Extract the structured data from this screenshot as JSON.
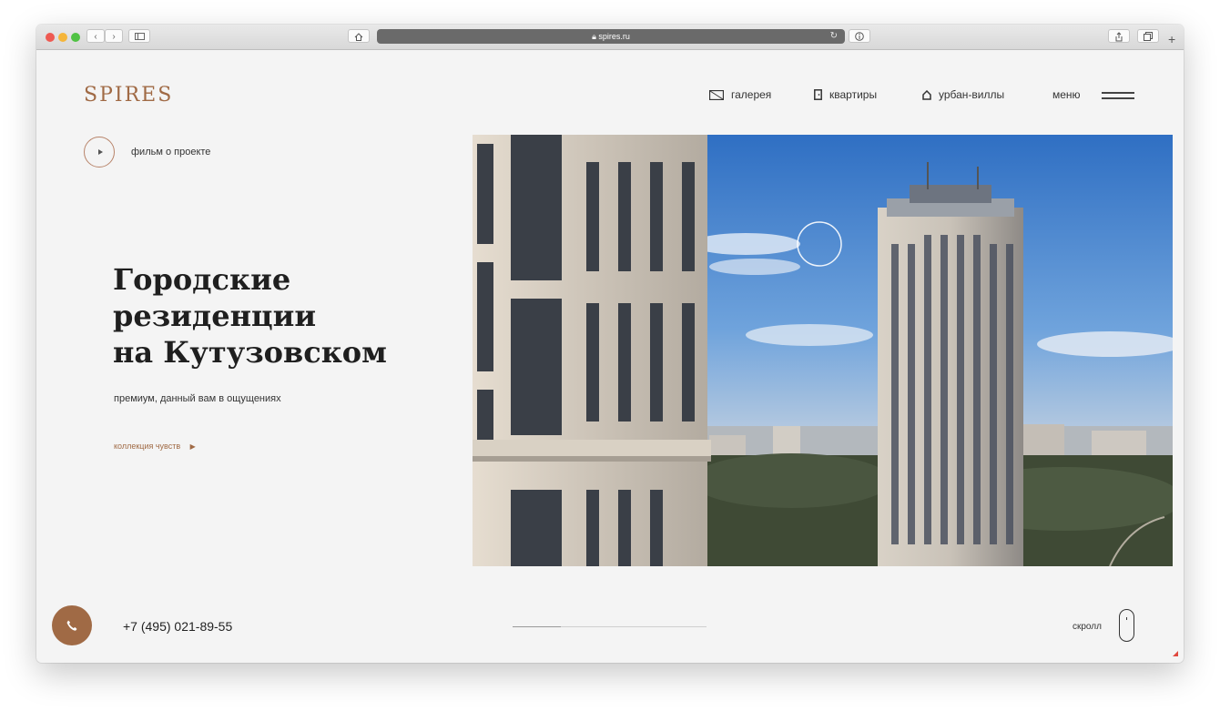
{
  "browser": {
    "url": "spires.ru",
    "traffic_lights": {
      "close": "#ee5a52",
      "minimize": "#f5b53a",
      "zoom": "#4fc243"
    }
  },
  "site": {
    "logo": "SPIRES",
    "nav": [
      {
        "label": "галерея",
        "icon": "gallery-icon"
      },
      {
        "label": "квартиры",
        "icon": "door-icon"
      },
      {
        "label": "урбан-виллы",
        "icon": "house-icon"
      }
    ],
    "menu_label": "меню",
    "film_label": "фильм о проекте",
    "headline": [
      "Городские",
      "резиденции",
      "на Кутузовском"
    ],
    "subtitle": "премиум, данный вам в ощущениях",
    "collection_link": "коллекция чувств",
    "phone": "+7 (495) 021-89-55",
    "scroll_label": "скролл",
    "slide_progress": 0.25,
    "accent_color": "#a06a45"
  }
}
